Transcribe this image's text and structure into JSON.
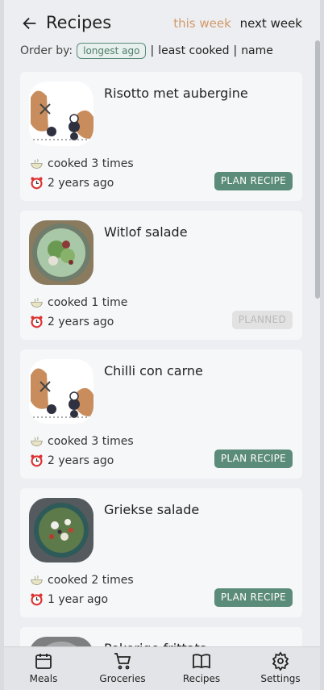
{
  "header": {
    "title": "Recipes",
    "tabs": [
      {
        "label": "this week",
        "active": true
      },
      {
        "label": "next week",
        "active": false
      }
    ]
  },
  "order": {
    "label": "Order by:",
    "selected": "longest ago",
    "options": [
      "least cooked",
      "name"
    ],
    "separator": "|"
  },
  "recipes": [
    {
      "name": "Risotto met aubergine",
      "cooked": "cooked 3 times",
      "last": "2 years ago",
      "button": "PLAN RECIPE",
      "state": "plan",
      "image": "placeholder-illustration"
    },
    {
      "name": "Witlof salade",
      "cooked": "cooked 1 time",
      "last": "2 years ago",
      "button": "PLANNED",
      "state": "planned",
      "image": "salad-photo"
    },
    {
      "name": "Chilli con carne",
      "cooked": "cooked 3 times",
      "last": "2 years ago",
      "button": "PLAN RECIPE",
      "state": "plan",
      "image": "placeholder-illustration"
    },
    {
      "name": "Griekse salade",
      "cooked": "cooked 2 times",
      "last": "1 year ago",
      "button": "PLAN RECIPE",
      "state": "plan",
      "image": "salad-photo"
    },
    {
      "name": "Pokerige frittata"
    }
  ],
  "nav": [
    {
      "label": "Meals",
      "icon": "calendar-icon"
    },
    {
      "label": "Groceries",
      "icon": "cart-icon"
    },
    {
      "label": "Recipes",
      "icon": "book-icon"
    },
    {
      "label": "Settings",
      "icon": "gear-icon"
    }
  ],
  "colors": {
    "accent": "#5b8b79",
    "tab_active": "#d19a6a",
    "planned_bg": "#e2e2e2"
  }
}
